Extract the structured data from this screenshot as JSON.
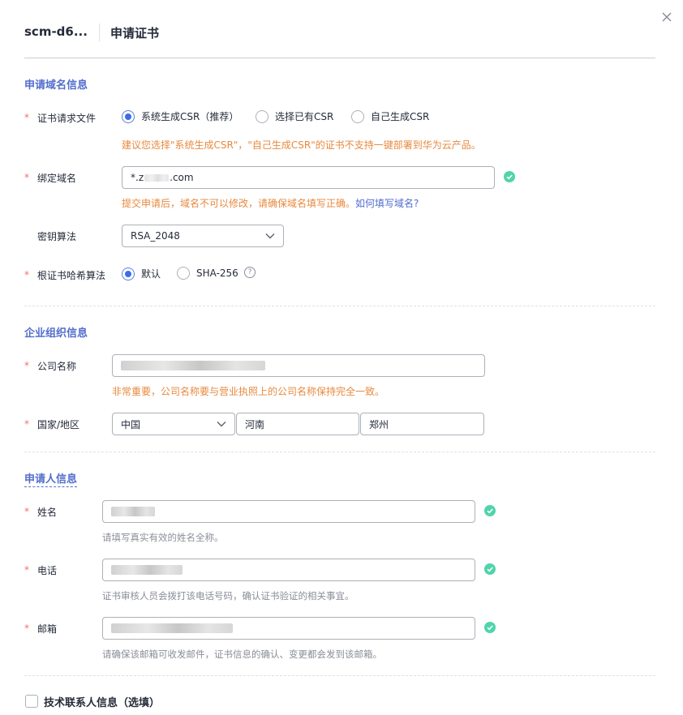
{
  "header": {
    "id_label": "scm-d6...",
    "title": "申请证书"
  },
  "sections": {
    "domain": "申请域名信息",
    "org": "企业组织信息",
    "applicant": "申请人信息",
    "tech": "技术联系人信息（选填）"
  },
  "required_mark": "*",
  "csr": {
    "label": "证书请求文件",
    "options": [
      "系统生成CSR（推荐）",
      "选择已有CSR",
      "自己生成CSR"
    ],
    "selected": "系统生成CSR（推荐）",
    "hint": "建议您选择\"系统生成CSR\"，\"自己生成CSR\"的证书不支持一键部署到华为云产品。"
  },
  "domain_name": {
    "label": "绑定域名",
    "value_prefix": "*.z",
    "value_suffix": ".com",
    "hint": "提交申请后，域名不可以修改，请确保域名填写正确。",
    "hint_link": "如何填写域名?"
  },
  "key_algo": {
    "label": "密钥算法",
    "value": "RSA_2048"
  },
  "hash_algo": {
    "label": "根证书哈希算法",
    "options": [
      "默认",
      "SHA-256"
    ],
    "selected": "默认",
    "help": "?"
  },
  "company": {
    "label": "公司名称",
    "hint": "非常重要，公司名称要与营业执照上的公司名称保持完全一致。"
  },
  "country": {
    "label": "国家/地区",
    "country_value": "中国",
    "province_value": "河南",
    "city_value": "郑州"
  },
  "name": {
    "label": "姓名",
    "hint": "请填写真实有效的姓名全称。"
  },
  "phone": {
    "label": "电话",
    "hint": "证书审核人员会拨打该电话号码，确认证书验证的相关事宜。"
  },
  "email": {
    "label": "邮箱",
    "hint": "请确保该邮箱可收发邮件，证书信息的确认、变更都会发到该邮箱。"
  },
  "colors": {
    "accent": "#526ecc",
    "radio": "#3a6ee8",
    "warning": "#e8893e",
    "success": "#50d4ab",
    "required": "#f66f6a"
  }
}
